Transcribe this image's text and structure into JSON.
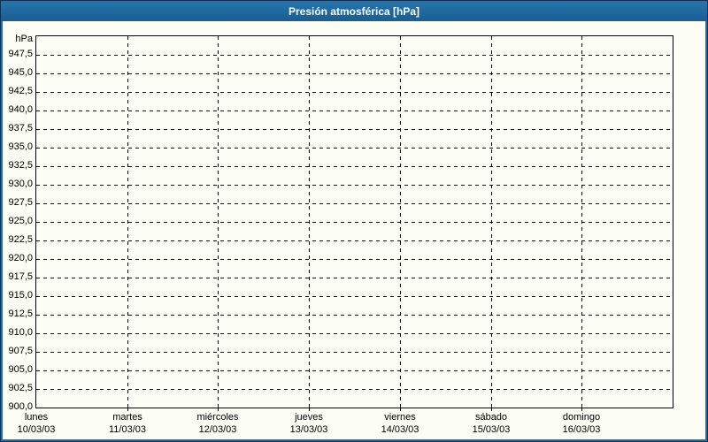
{
  "title": "Presión atmosférica [hPa]",
  "colors": {
    "frame_outer": "#0d3056",
    "frame_inner": "#2a6ea6",
    "titlebar": "#1f68a0",
    "background": "#fcfdf4",
    "grid": "#000000",
    "text": "#000000",
    "title_text": "#ffffff"
  },
  "chart_data": {
    "type": "line",
    "title": "Presión atmosférica [hPa]",
    "legend": "none",
    "grid": "dashed",
    "y_axis": {
      "unit_label": "hPa",
      "min": 900,
      "max": 950,
      "tick_step": 2.5,
      "tick_labels": [
        "947,5",
        "945,0",
        "942,5",
        "940,0",
        "937,5",
        "935,0",
        "932,5",
        "930,0",
        "927,5",
        "925,0",
        "922,5",
        "920,0",
        "917,5",
        "915,0",
        "912,5",
        "910,0",
        "907,5",
        "905,0",
        "902,5",
        "900,0"
      ]
    },
    "x_axis": {
      "days": [
        {
          "name": "lunes",
          "date": "10/03/03"
        },
        {
          "name": "martes",
          "date": "11/03/03"
        },
        {
          "name": "miércoles",
          "date": "12/03/03"
        },
        {
          "name": "jueves",
          "date": "13/03/03"
        },
        {
          "name": "viernes",
          "date": "14/03/03"
        },
        {
          "name": "sábado",
          "date": "15/03/03"
        },
        {
          "name": "domingo",
          "date": "16/03/03"
        }
      ]
    },
    "series": []
  }
}
